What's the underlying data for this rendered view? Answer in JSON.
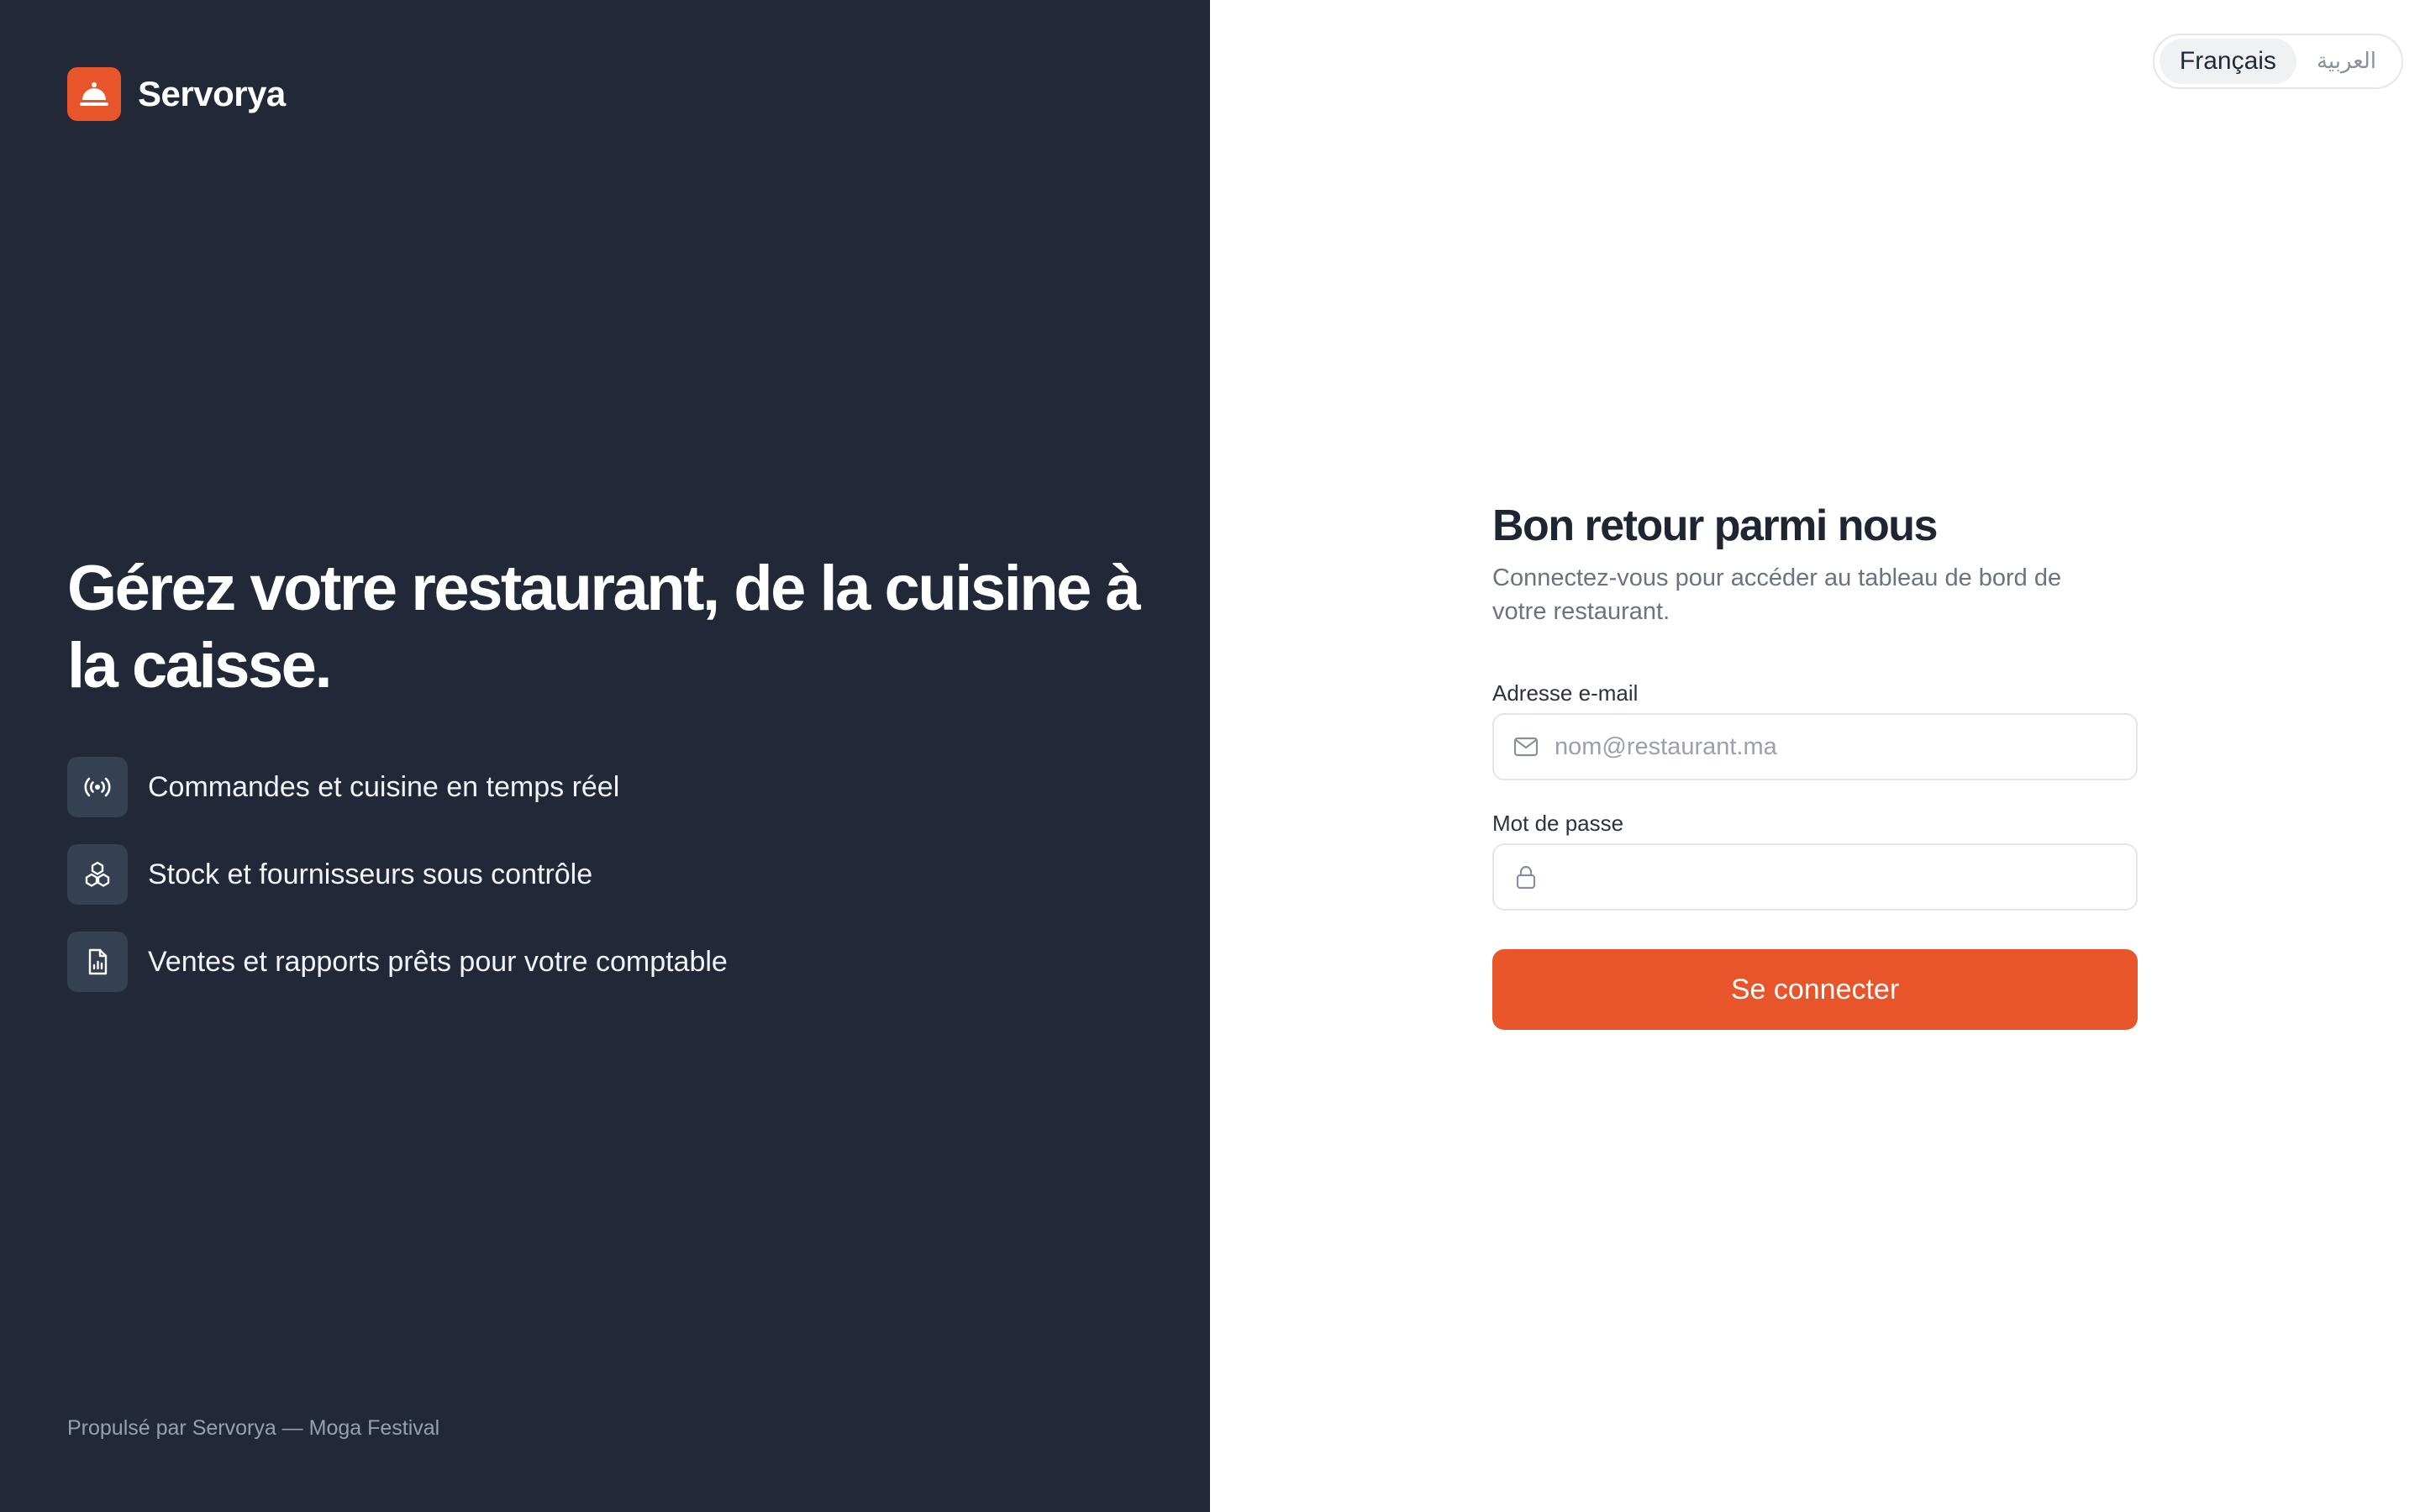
{
  "brand": {
    "name": "Servorya",
    "logo_icon": "service-bell-icon",
    "accent_color": "#e8552a"
  },
  "hero": {
    "headline": "Gérez votre restaurant, de la cuisine à la caisse.",
    "features": [
      {
        "icon": "broadcast-icon",
        "label": "Commandes et cuisine en temps réel"
      },
      {
        "icon": "stack-boxes-icon",
        "label": "Stock et fournisseurs sous contrôle"
      },
      {
        "icon": "report-file-icon",
        "label": "Ventes et rapports prêts pour votre comptable"
      }
    ]
  },
  "footer": {
    "text": "Propulsé par Servorya — Moga Festival"
  },
  "language_switcher": {
    "options": [
      "Français",
      "العربية"
    ],
    "selected": "Français"
  },
  "login": {
    "title": "Bon retour parmi nous",
    "subtitle": "Connectez-vous pour accéder au tableau de bord de votre restaurant.",
    "email": {
      "label": "Adresse e-mail",
      "placeholder": "nom@restaurant.ma",
      "value": "",
      "icon": "mail-icon"
    },
    "password": {
      "label": "Mot de passe",
      "placeholder": "",
      "value": "",
      "icon": "lock-icon"
    },
    "submit_label": "Se connecter"
  },
  "colors": {
    "left_panel_bg": "#212838",
    "right_panel_bg": "#ffffff",
    "button_bg": "#e8552a"
  }
}
